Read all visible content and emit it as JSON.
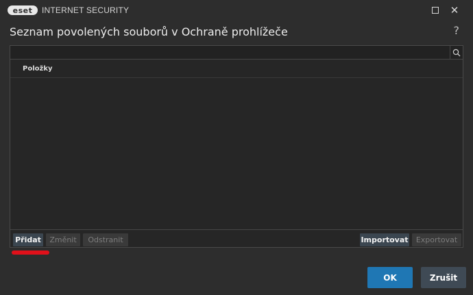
{
  "titlebar": {
    "logo_text": "eset",
    "app_name": "INTERNET SECURITY"
  },
  "dialog": {
    "title": "Seznam povolených souborů v Ochraně prohlížeče",
    "help": "?"
  },
  "search": {
    "value": "",
    "placeholder": ""
  },
  "list": {
    "column_header": "Položky",
    "items": []
  },
  "toolbar": {
    "add_label": "Přidat",
    "edit_label": "Změnit",
    "remove_label": "Odstranit",
    "import_label": "Importovat",
    "export_label": "Exportovat"
  },
  "footer": {
    "ok_label": "OK",
    "cancel_label": "Zrušit"
  },
  "colors": {
    "background": "#2d2d2d",
    "accent": "#1f77b4",
    "highlight_mark": "#e0101a"
  }
}
